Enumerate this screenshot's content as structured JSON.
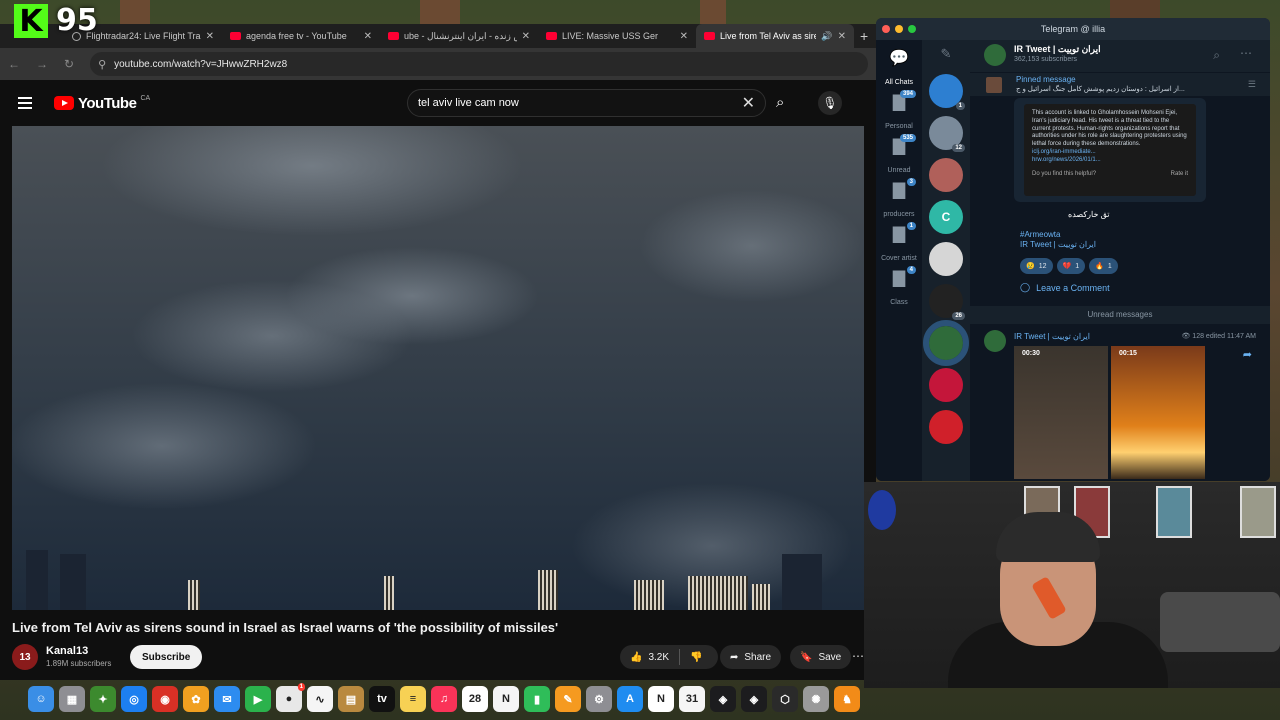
{
  "overlay": {
    "logo": "K",
    "count": "95"
  },
  "browser": {
    "tabs": [
      {
        "title": "Flightradar24: Live Flight Tra",
        "favicon": "globe",
        "active": false
      },
      {
        "title": "agenda free tv - YouTube",
        "favicon": "youtube",
        "active": false
      },
      {
        "title": "ube - پخش زنده - ایران اینترنشنال",
        "favicon": "youtube",
        "active": false
      },
      {
        "title": "LIVE: Massive USS Ger",
        "favicon": "youtube",
        "active": false
      },
      {
        "title": "Live from Tel Aviv as siren",
        "favicon": "youtube",
        "active": true
      }
    ],
    "url": "youtube.com/watch?v=JHwwZRH2wz8"
  },
  "youtube": {
    "wordmark": "YouTube",
    "country": "CA",
    "search_query": "tel aviv live cam now",
    "video_title": "Live from Tel Aviv as sirens sound in Israel as Israel warns of 'the possibility of missiles'",
    "channel_name": "Kanal13",
    "channel_avatar_text": "13",
    "subscribers": "1.89M subscribers",
    "subscribe_label": "Subscribe",
    "likes": "3.2K",
    "share_label": "Share",
    "save_label": "Save"
  },
  "telegram": {
    "window_title": "Telegram @ illia",
    "folders": [
      {
        "label": "All Chats",
        "badge": "",
        "active": true
      },
      {
        "label": "Personal",
        "badge": "394",
        "active": false
      },
      {
        "label": "Unread",
        "badge": "535",
        "active": false
      },
      {
        "label": "producers",
        "badge": "3",
        "active": false
      },
      {
        "label": "Cover artist",
        "badge": "1",
        "active": false
      },
      {
        "label": "Class",
        "badge": "4",
        "active": false
      }
    ],
    "chats": [
      {
        "badge": "1",
        "color": "#2d7fd1",
        "text": ""
      },
      {
        "badge": "12",
        "color": "#7a8a9a",
        "text": ""
      },
      {
        "badge": "",
        "color": "#b0605a",
        "text": ""
      },
      {
        "badge": "",
        "color": "#2fb8a6",
        "text": "C"
      },
      {
        "badge": "",
        "color": "#d6d6d6",
        "text": ""
      },
      {
        "badge": "26",
        "color": "#222222",
        "text": ""
      },
      {
        "badge": "",
        "color": "#2f6b3a",
        "text": "",
        "selected": true
      },
      {
        "badge": "",
        "color": "#c4163a",
        "text": ""
      },
      {
        "badge": "",
        "color": "#d0202a",
        "text": ""
      }
    ],
    "channel_name": "IR Tweet | ایران توییت",
    "channel_subscribers": "362,153 subscribers",
    "pinned_label": "Pinned message",
    "pinned_text": "از اسرائیل : دوستان زدیم پوشش کامل جنگ اسرائیل و ج...",
    "card_text": "This account is linked to Gholamhossein Mohseni Ejei, Iran's judiciary head. His tweet is a threat tied to the current protests. Human-rights organizations report that authorities under his role are slaughtering protesters using lethal force during these demonstrations.",
    "card_link1": "iclj.org/iran-immediate...",
    "card_link2": "hrw.org/news/2026/01/1...",
    "card_helpful": "Do you find this helpful?",
    "card_rate": "Rate it",
    "caption": "تق خارکصده",
    "author_tag": "#Armeowta",
    "author_channel": "IR Tweet | ایران توییت",
    "reactions": [
      {
        "emoji": "😢",
        "count": "12"
      },
      {
        "emoji": "💔",
        "count": "1"
      },
      {
        "emoji": "🔥",
        "count": "1"
      }
    ],
    "leave_comment": "Leave a Comment",
    "unread_label": "Unread messages",
    "msg2_author": "IR Tweet | ایران توییت",
    "msg2_meta": "👁 128 edited 11:47 AM",
    "media_durations": [
      "00:30",
      "00:15"
    ]
  },
  "dock": [
    {
      "name": "finder",
      "color": "#3a8ee6",
      "glyph": "☺",
      "badge": ""
    },
    {
      "name": "launchpad",
      "color": "#8e8e93",
      "glyph": "▦",
      "badge": ""
    },
    {
      "name": "app-green",
      "color": "#3c8a2e",
      "glyph": "✦",
      "badge": ""
    },
    {
      "name": "safari",
      "color": "#1d7ff0",
      "glyph": "◎",
      "badge": ""
    },
    {
      "name": "chrome",
      "color": "#d93025",
      "glyph": "◉",
      "badge": ""
    },
    {
      "name": "photos",
      "color": "#f0a020",
      "glyph": "✿",
      "badge": ""
    },
    {
      "name": "mail",
      "color": "#2d8cf0",
      "glyph": "✉",
      "badge": ""
    },
    {
      "name": "facetime",
      "color": "#2bb24c",
      "glyph": "▶",
      "badge": ""
    },
    {
      "name": "messages",
      "color": "#e8e8e8",
      "glyph": "●",
      "badge": "1"
    },
    {
      "name": "freeform",
      "color": "#f5f5f5",
      "glyph": "∿",
      "badge": ""
    },
    {
      "name": "finder-folder",
      "color": "#b9893f",
      "glyph": "▤",
      "badge": ""
    },
    {
      "name": "apple-tv",
      "color": "#111111",
      "glyph": "tv",
      "badge": ""
    },
    {
      "name": "notes",
      "color": "#f7d154",
      "glyph": "≡",
      "badge": ""
    },
    {
      "name": "music",
      "color": "#fa3358",
      "glyph": "♫",
      "badge": ""
    },
    {
      "name": "calendar",
      "color": "#ffffff",
      "glyph": "28",
      "badge": ""
    },
    {
      "name": "news",
      "color": "#f5f5f5",
      "glyph": "N",
      "badge": ""
    },
    {
      "name": "numbers",
      "color": "#2fbd59",
      "glyph": "▮",
      "badge": ""
    },
    {
      "name": "pages",
      "color": "#f59a20",
      "glyph": "✎",
      "badge": ""
    },
    {
      "name": "system-settings",
      "color": "#8e8e93",
      "glyph": "⚙",
      "badge": ""
    },
    {
      "name": "app-store",
      "color": "#1f8cf0",
      "glyph": "A",
      "badge": ""
    },
    {
      "name": "notion",
      "color": "#ffffff",
      "glyph": "N",
      "badge": ""
    },
    {
      "name": "calendar-31",
      "color": "#f5f5f5",
      "glyph": "31",
      "badge": ""
    },
    {
      "name": "app-dark",
      "color": "#1c1c1e",
      "glyph": "◈",
      "badge": ""
    },
    {
      "name": "app-dark-2",
      "color": "#1c1c1e",
      "glyph": "◈",
      "badge": ""
    },
    {
      "name": "app-hex",
      "color": "#2a2a2a",
      "glyph": "⬡",
      "badge": ""
    },
    {
      "name": "app-gear",
      "color": "#9a9a9a",
      "glyph": "✺",
      "badge": ""
    },
    {
      "name": "app-orange",
      "color": "#f28b18",
      "glyph": "♞",
      "badge": ""
    }
  ]
}
